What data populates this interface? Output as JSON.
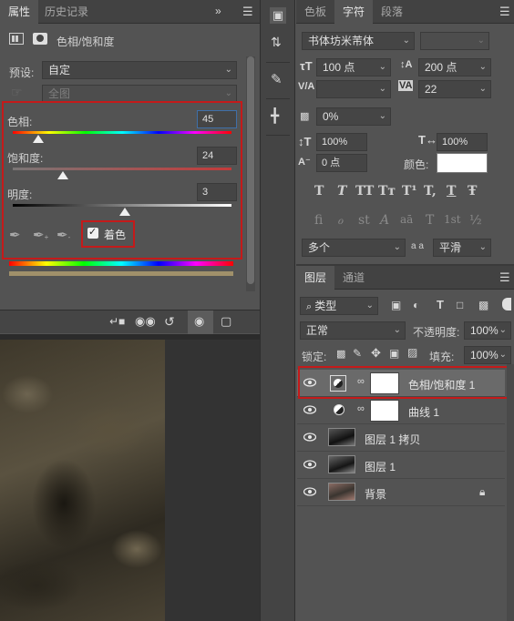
{
  "properties_panel": {
    "tabs": [
      "属性",
      "历史记录"
    ],
    "collapse_icon": "double-chevron-right",
    "menu_icon": "hamburger",
    "title": "色相/饱和度",
    "preset_label": "预设:",
    "preset_value": "自定",
    "channel_value": "全图",
    "hue_label": "色相:",
    "hue_value": "45",
    "saturation_label": "饱和度:",
    "saturation_value": "24",
    "lightness_label": "明度:",
    "lightness_value": "3",
    "colorize_label": "着色",
    "colorize_checked": true,
    "colorize_bar_color": "#a0906a",
    "slider_levels": {
      "hue": 0.14,
      "saturation": 0.24,
      "lightness": 0.515
    }
  },
  "character_panel": {
    "tabs": [
      "色板",
      "字符",
      "段落"
    ],
    "font_family": "书体坊米芾体",
    "font_size": "100 点",
    "leading": "200 点",
    "kerning": "",
    "tracking": "22",
    "tsume": "0%",
    "vertical_scale": "100%",
    "horizontal_scale": "100%",
    "baseline_shift": "0 点",
    "color_label": "颜色:",
    "color_value": "#ffffff",
    "language": "多个",
    "aa_label": "a a",
    "anti_alias": "平滑",
    "style_glyphs": [
      "T",
      "T",
      "TT",
      "Tт",
      "T¹",
      "T,",
      "T",
      "Ŧ"
    ],
    "opentype_glyphs": [
      "fi",
      "ℴ",
      "st",
      "A",
      "aā",
      "T",
      "1st",
      "½"
    ]
  },
  "layers_panel": {
    "tabs": [
      "图层",
      "通道"
    ],
    "filter_value": "类型",
    "blend_mode": "正常",
    "opacity_label": "不透明度:",
    "opacity_value": "100%",
    "lock_label": "锁定:",
    "fill_label": "填充:",
    "fill_value": "100%",
    "layers": [
      {
        "name": "色相/饱和度 1",
        "type": "adjustment",
        "selected": true
      },
      {
        "name": "曲线 1",
        "type": "adjustment",
        "selected": false
      },
      {
        "name": "图层 1 拷贝",
        "type": "pixel",
        "selected": false
      },
      {
        "name": "图层 1",
        "type": "pixel",
        "selected": false
      },
      {
        "name": "背景",
        "type": "background",
        "locked": true,
        "selected": false
      }
    ]
  },
  "colors": {
    "highlight_red": "#c41a1a",
    "panel_bg": "#535353"
  }
}
